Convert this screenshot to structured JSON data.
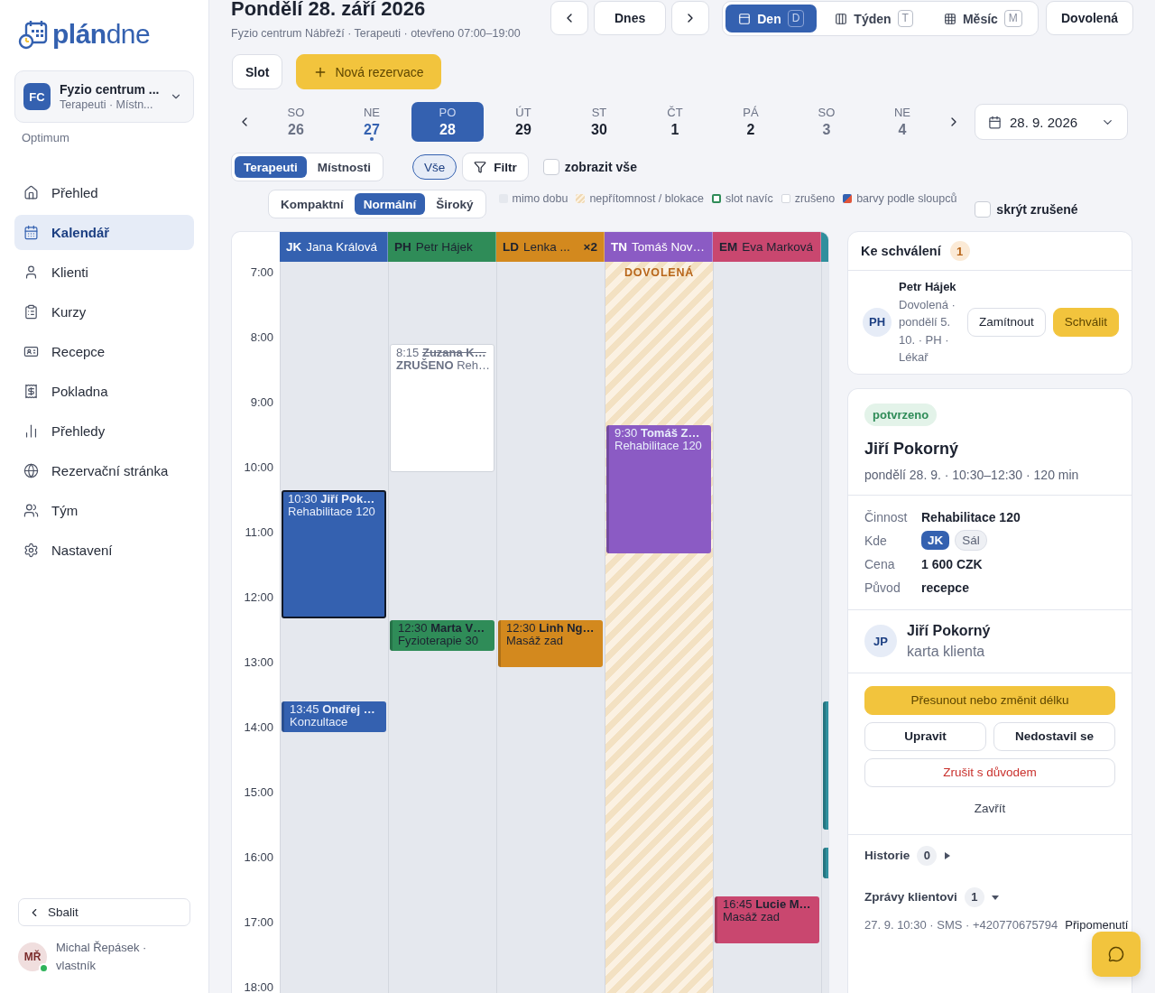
{
  "sidebar": {
    "logo": {
      "bold": "plán",
      "light": "dne"
    },
    "org": {
      "initials": "FC",
      "name": "Fyzio centrum ...",
      "sub": "Terapeuti · Místn..."
    },
    "plan": "Optimum",
    "nav": [
      {
        "label": "Přehled",
        "selected": false
      },
      {
        "label": "Kalendář",
        "selected": true
      },
      {
        "label": "Klienti",
        "selected": false
      },
      {
        "label": "Kurzy",
        "selected": false
      },
      {
        "label": "Recepce",
        "selected": false
      },
      {
        "label": "Pokladna",
        "selected": false
      },
      {
        "label": "Přehledy",
        "selected": false
      },
      {
        "label": "Rezervační stránka",
        "selected": false
      },
      {
        "label": "Tým",
        "selected": false
      },
      {
        "label": "Nastavení",
        "selected": false
      }
    ],
    "collapse": "Sbalit",
    "user": {
      "initials": "MŘ",
      "name": "Michal Řepásek ·",
      "role": "vlastník",
      "online": true
    }
  },
  "header": {
    "title": "Pondělí 28. září 2026",
    "subtitle": "Fyzio centrum Nábřeží · Terapeuti · otevřeno 07:00–19:00",
    "today": "Dnes",
    "views": [
      {
        "label": "Den",
        "key": "D",
        "selected": true
      },
      {
        "label": "Týden",
        "key": "T",
        "selected": false
      },
      {
        "label": "Měsíc",
        "key": "M",
        "selected": false
      }
    ],
    "vacation": "Dovolená"
  },
  "actions": {
    "slot": "Slot",
    "new": "Nová rezervace"
  },
  "days": [
    {
      "weekday": "SO",
      "date": "26",
      "selected": false,
      "weekend": true,
      "today": false
    },
    {
      "weekday": "NE",
      "date": "27",
      "selected": false,
      "weekend": true,
      "today": true
    },
    {
      "weekday": "PO",
      "date": "28",
      "selected": true,
      "weekend": false,
      "today": false
    },
    {
      "weekday": "ÚT",
      "date": "29",
      "selected": false,
      "weekend": false,
      "today": false
    },
    {
      "weekday": "ST",
      "date": "30",
      "selected": false,
      "weekend": false,
      "today": false
    },
    {
      "weekday": "ČT",
      "date": "1",
      "selected": false,
      "weekend": false,
      "today": false
    },
    {
      "weekday": "PÁ",
      "date": "2",
      "selected": false,
      "weekend": false,
      "today": false
    },
    {
      "weekday": "SO",
      "date": "3",
      "selected": false,
      "weekend": true,
      "today": false
    },
    {
      "weekday": "NE",
      "date": "4",
      "selected": false,
      "weekend": true,
      "today": false
    }
  ],
  "date_picker": {
    "value": "28. 9. 2026"
  },
  "filters": {
    "modes": [
      {
        "label": "Terapeuti",
        "selected": true
      },
      {
        "label": "Místnosti",
        "selected": false
      }
    ],
    "all": {
      "label": "Vše",
      "selected": true
    },
    "filter": "Filtr",
    "show_all": {
      "label": "zobrazit vše",
      "checked": false
    }
  },
  "density": [
    {
      "label": "Kompaktní",
      "selected": false
    },
    {
      "label": "Normální",
      "selected": true
    },
    {
      "label": "Široký",
      "selected": false
    }
  ],
  "legend": [
    {
      "kind": "outside",
      "label": "mimo dobu"
    },
    {
      "kind": "absence",
      "label": "nepřítomnost / blokace"
    },
    {
      "kind": "extra",
      "label": "slot navíc"
    },
    {
      "kind": "cancelled",
      "label": "zrušeno"
    },
    {
      "kind": "columns",
      "label": "barvy podle sloupců"
    }
  ],
  "hide_cancelled": {
    "label": "skrýt zrušené",
    "checked": false
  },
  "calendar": {
    "hours": [
      "7:00",
      "8:00",
      "9:00",
      "10:00",
      "11:00",
      "12:00",
      "13:00",
      "14:00",
      "15:00",
      "16:00",
      "17:00",
      "18:00"
    ],
    "columns": [
      {
        "initials": "JK",
        "name": "Jana Králová",
        "color": "#3461b0",
        "events": [
          {
            "kind": "booking",
            "time": "10:30",
            "client": "Jiří Pok…",
            "service": "Rehabilitace 120",
            "selected": true
          },
          {
            "kind": "booking",
            "time": "13:45",
            "client": "Ondřej …",
            "service": "Konzultace",
            "selected": false
          }
        ]
      },
      {
        "initials": "PH",
        "name": "Petr Hájek",
        "color": "#2f8c58",
        "events": [
          {
            "kind": "cancelled",
            "time": "8:15",
            "client": "Zuzana K…",
            "status": "ZRUŠENO",
            "service": "Reh…",
            "selected": false
          },
          {
            "kind": "booking",
            "time": "12:30",
            "client": "Marta V…",
            "service": "Fyzioterapie 30",
            "selected": false
          }
        ]
      },
      {
        "initials": "LD",
        "name": "Lenka ...",
        "count": "×2",
        "color": "#d3891e",
        "events": [
          {
            "kind": "booking",
            "time": "12:30",
            "client": "Linh Ng…",
            "service": "Masáž zad",
            "selected": false
          }
        ]
      },
      {
        "initials": "TN",
        "name": "Tomáš Nov…",
        "color": "#8b5bc4",
        "absence": "DOVOLENÁ",
        "events": [
          {
            "kind": "booking",
            "time": "9:30",
            "client": "Tomáš Z…",
            "service": "Rehabilitace 120",
            "selected": false
          }
        ]
      },
      {
        "initials": "EM",
        "name": "Eva Marková",
        "color": "#c9476f",
        "events": [
          {
            "kind": "booking",
            "time": "16:45",
            "client": "Lucie M…",
            "service": "Masáž zad",
            "selected": false
          }
        ]
      },
      {
        "color": "#2f8f9d",
        "events": [
          {
            "kind": "booking",
            "selected": false
          },
          {
            "kind": "booking",
            "selected": false
          }
        ]
      }
    ]
  },
  "approvals": {
    "title": "Ke schválení",
    "count": "1",
    "items": [
      {
        "initials": "PH",
        "name": "Petr Hájek",
        "detail": "Dovolená · pondělí 5. 10. · PH · Lékař",
        "reject": "Zamítnout",
        "approve": "Schválit"
      }
    ]
  },
  "detail": {
    "status": "potvrzeno",
    "title": "Jiří Pokorný",
    "when": "pondělí 28. 9. · 10:30–12:30 · 120 min",
    "fields": [
      {
        "label": "Činnost",
        "value": "Rehabilitace 120"
      },
      {
        "label": "Kde",
        "tags": [
          {
            "text": "JK",
            "kind": "therapist"
          },
          {
            "text": "Sál",
            "kind": "room"
          }
        ]
      },
      {
        "label": "Cena",
        "value": "1 600 CZK"
      },
      {
        "label": "Původ",
        "value": "recepce"
      }
    ],
    "client": {
      "initials": "JP",
      "name": "Jiří Pokorný",
      "sub": "karta klienta"
    },
    "actions": {
      "move": "Přesunout nebo změnit délku",
      "edit": "Upravit",
      "noshow": "Nedostavil se",
      "cancel": "Zrušit s důvodem",
      "close": "Zavřít"
    },
    "history": {
      "label": "Historie",
      "count": "0",
      "expanded": false
    },
    "messages": {
      "label": "Zprávy klientovi",
      "count": "1",
      "expanded": true,
      "items": [
        {
          "meta": "27. 9. 10:30 · SMS · +420770675794",
          "text": "Připomenutí"
        }
      ]
    }
  }
}
